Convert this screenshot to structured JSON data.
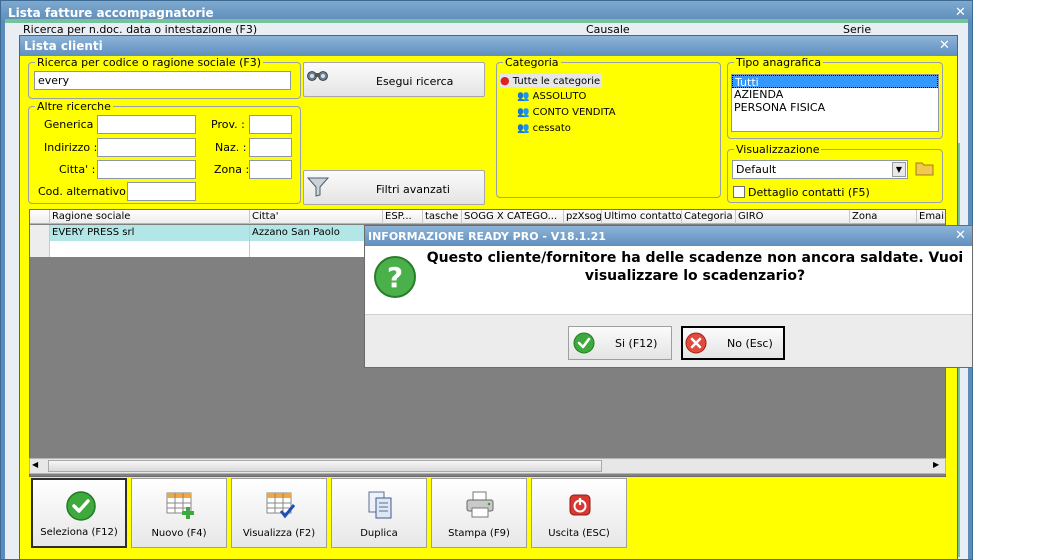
{
  "back_window": {
    "title": "Lista fatture accompagnatorie",
    "search_label": "Ricerca per n.doc. data o intestazione (F3)",
    "col_causale": "Causale",
    "col_serie": "Serie"
  },
  "clienti": {
    "title": "Lista clienti",
    "search": {
      "legend": "Ricerca per codice o ragione sociale (F3)",
      "value": "every",
      "button": "Esegui ricerca"
    },
    "altre": {
      "legend": "Altre ricerche",
      "generica": "Generica :",
      "indirizzo": "Indirizzo :",
      "citta": "Citta' :",
      "cod_alt": "Cod. alternativo :",
      "prov": "Prov. :",
      "naz": "Naz. :",
      "zona": "Zona :"
    },
    "filtri_button": "Filtri avanzati",
    "categoria": {
      "legend": "Categoria",
      "root": "Tutte le categorie",
      "items": [
        "ASSOLUTO",
        "CONTO VENDITA",
        "cessato"
      ]
    },
    "tipo": {
      "legend": "Tipo anagrafica",
      "options": [
        "Tutti",
        "AZIENDA",
        "PERSONA FISICA"
      ],
      "selected": "Tutti"
    },
    "visualizzazione": {
      "legend": "Visualizzazione",
      "value": "Default",
      "dettaglio": "Dettaglio contatti (F5)"
    },
    "grid": {
      "columns": [
        "Ragione sociale",
        "Citta'",
        "ESP...",
        "tasche",
        "SOGG X CATEGO...",
        "pzXsog",
        "Ultimo contatto",
        "Categoria",
        "GIRO",
        "Zona",
        "Email"
      ],
      "rows": [
        {
          "ragione": "EVERY PRESS srl",
          "citta": "Azzano San Paolo"
        }
      ]
    },
    "toolbar": [
      {
        "label": "Seleziona (F12)",
        "icon": "check-circle-icon"
      },
      {
        "label": "Nuovo (F4)",
        "icon": "grid-add-icon"
      },
      {
        "label": "Visualizza (F2)",
        "icon": "grid-check-icon"
      },
      {
        "label": "Duplica",
        "icon": "copy-icon"
      },
      {
        "label": "Stampa (F9)",
        "icon": "printer-icon"
      },
      {
        "label": "Uscita (ESC)",
        "icon": "power-icon"
      }
    ]
  },
  "dialog": {
    "title": "INFORMAZIONE READY PRO - V18.1.21",
    "message_line1": "Questo cliente/fornitore ha delle scadenze non ancora saldate. Vuoi",
    "message_line2": "visualizzare lo scadenzario?",
    "yes": "Si (F12)",
    "no": "No (Esc)"
  },
  "colors": {
    "accent_yellow": "#ffff00",
    "title_blue": "#5f8fbe",
    "row_selected": "#b3e6e6"
  }
}
